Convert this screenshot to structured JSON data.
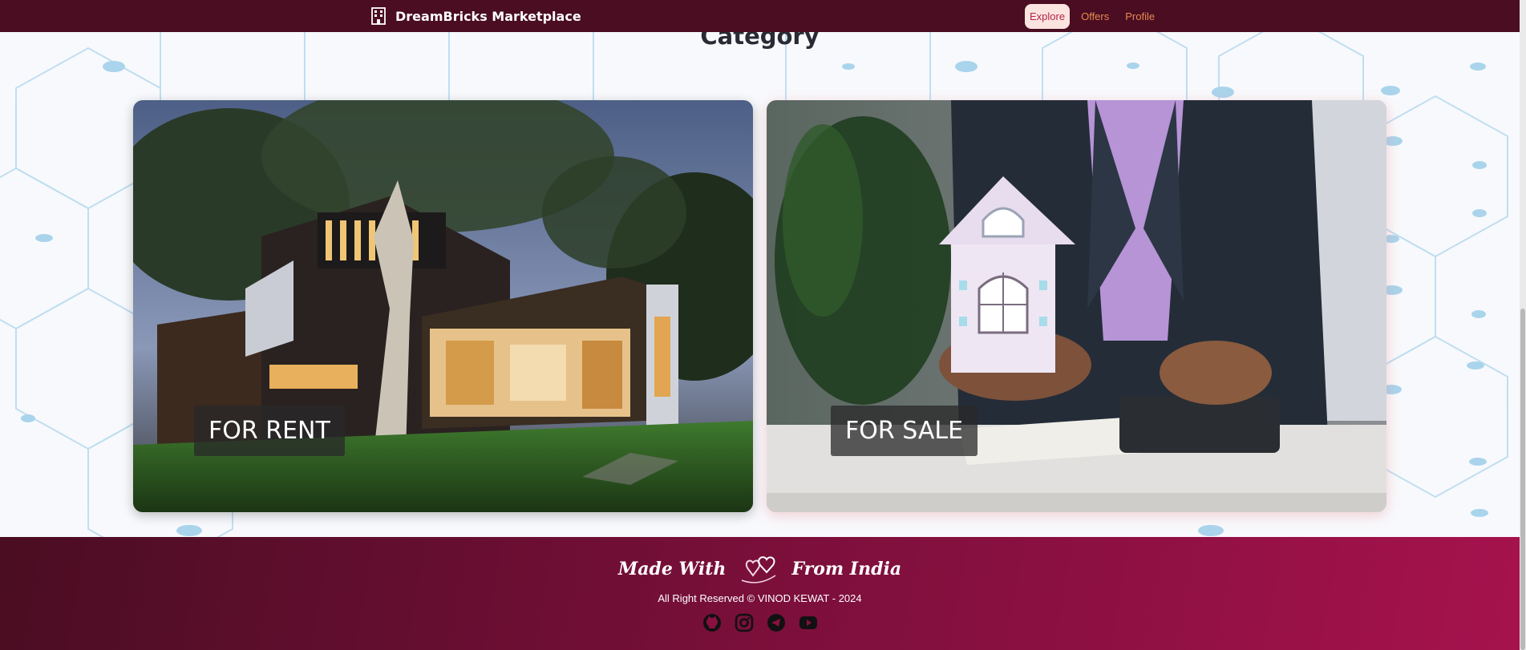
{
  "navbar": {
    "brand_title": "DreamBricks Marketplace",
    "brand_icon": "building-icon",
    "links": [
      {
        "label": "Explore",
        "active": true
      },
      {
        "label": "Offers",
        "active": false
      },
      {
        "label": "Profile",
        "active": false
      }
    ]
  },
  "main": {
    "heading": "Category",
    "cards": [
      {
        "label": "FOR RENT",
        "image": "modern-house-photo"
      },
      {
        "label": "FOR SALE",
        "image": "agent-holding-house-model-photo"
      }
    ]
  },
  "footer": {
    "made_with": "Made With",
    "from_india": "From India",
    "heart_icon": "heart-icon",
    "copyright": "All Right Reserved © VINOD KEWAT - 2024",
    "socials": [
      "github-icon",
      "instagram-icon",
      "telegram-icon",
      "youtube-icon"
    ]
  },
  "colors": {
    "navbar_bg": "#4a0d22",
    "nav_link": "#e68a4f",
    "nav_active_bg": "#fbe3df",
    "footer_start": "#4a0d22",
    "footer_end": "#a6124d"
  }
}
